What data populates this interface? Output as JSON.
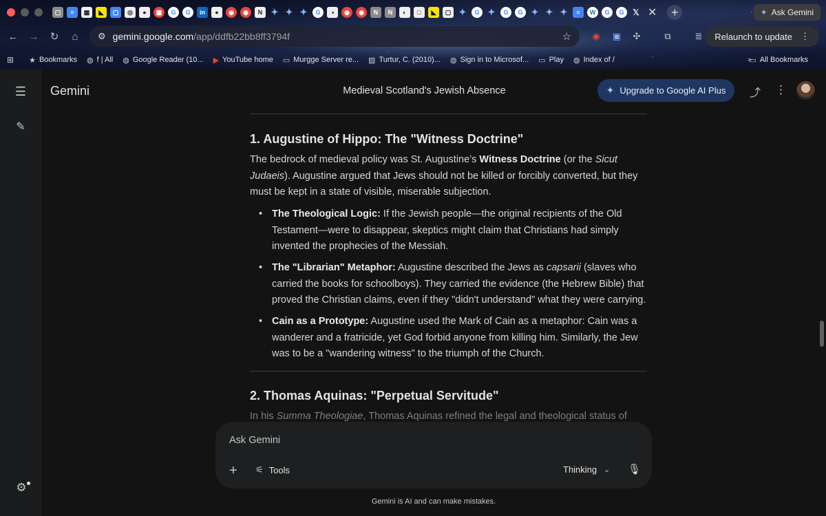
{
  "browser": {
    "ask_gemini": "Ask Gemini",
    "url_host": "gemini.google.com",
    "url_path": "/app/ddfb22bb8ff3794f",
    "relaunch": "Relaunch to update",
    "bookmarks": [
      {
        "label": "Bookmarks",
        "icon": "star-icon"
      },
      {
        "label": "f | All",
        "icon": "globe-icon"
      },
      {
        "label": "Google Reader (10...",
        "icon": "globe-icon"
      },
      {
        "label": "YouTube home",
        "icon": "youtube-icon"
      },
      {
        "label": "Murgge Server re...",
        "icon": "folder-icon"
      },
      {
        "label": "Turtur, C. (2010)...",
        "icon": "image-icon"
      },
      {
        "label": "Sign in to Microsof...",
        "icon": "globe-icon"
      },
      {
        "label": "Play",
        "icon": "folder-icon"
      },
      {
        "label": "Index of /",
        "icon": "globe-icon"
      }
    ],
    "all_bookmarks": "All Bookmarks"
  },
  "app": {
    "brand": "Gemini",
    "conversation_title": "Medieval Scotland's Jewish Absence",
    "upgrade_label": "Upgrade to Google AI Plus",
    "accent": "#1f3760"
  },
  "article": {
    "section1_heading": "1. Augustine of Hippo: The \"Witness Doctrine\"",
    "section1_intro": {
      "pre": "The bedrock of medieval policy was St. Augustine’s ",
      "bold": "Witness Doctrine",
      "mid": " (or the ",
      "italic": "Sicut Judaeis",
      "post": "). Augustine argued that Jews should not be killed or forcibly converted, but they must be kept in a state of visible, miserable subjection."
    },
    "bullets": [
      {
        "title": "The Theological Logic:",
        "text": " If the Jewish people—the original recipients of the Old Testament—were to disappear, skeptics might claim that Christians had simply invented the prophecies of the Messiah."
      },
      {
        "title": "The \"Librarian\" Metaphor:",
        "text_pre": " Augustine described the Jews as ",
        "italic": "capsarii",
        "text": " (slaves who carried the books for schoolboys). They carried the evidence (the Hebrew Bible) that proved the Christian claims, even if they \"didn't understand\" what they were carrying."
      },
      {
        "title": "Cain as a Prototype:",
        "text": " Augustine used the Mark of Cain as a metaphor: Cain was a wanderer and a fratricide, yet God forbid anyone from killing him. Similarly, the Jew was to be a \"wandering witness\" to the triumph of the Church."
      }
    ],
    "section2_heading": "2. Thomas Aquinas: \"Perpetual Servitude\"",
    "section2_intro": {
      "pre": "In his ",
      "italic": "Summa Theologiae",
      "post": ", Thomas Aquinas refined the legal and theological status of Jewish"
    }
  },
  "composer": {
    "placeholder": "Ask Gemini",
    "tools_label": "Tools",
    "mode_label": "Thinking"
  },
  "disclaimer": "Gemini is AI and can make mistakes."
}
